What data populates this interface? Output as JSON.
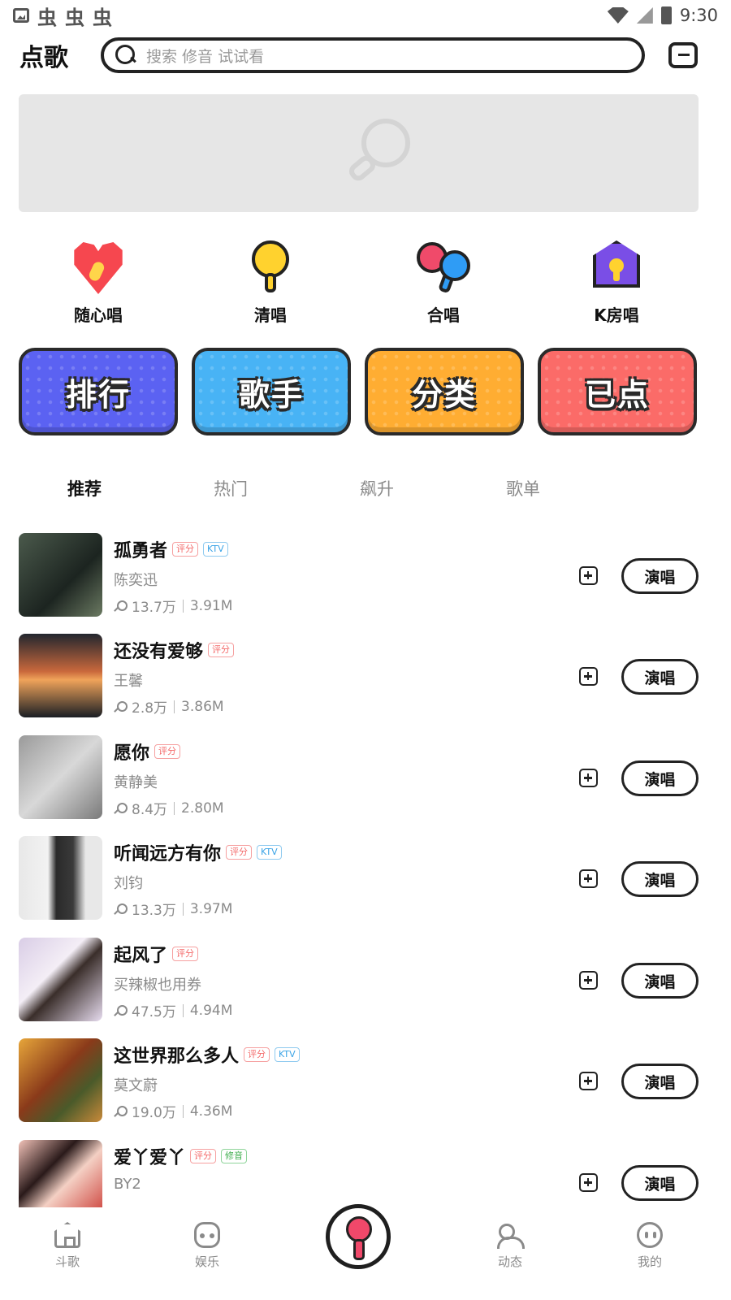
{
  "status_bar": {
    "time": "9:30",
    "bug_icons": [
      "虫",
      "虫",
      "虫"
    ]
  },
  "header": {
    "title": "点歌",
    "search_placeholder": "搜索 修音 试试看"
  },
  "quick_actions": [
    {
      "label": "随心唱",
      "icon": "heart-mic-icon"
    },
    {
      "label": "清唱",
      "icon": "yellow-mic-icon"
    },
    {
      "label": "合唱",
      "icon": "duet-mic-icon"
    },
    {
      "label": "K房唱",
      "icon": "ktv-room-icon"
    }
  ],
  "categories": [
    {
      "label": "排行",
      "color": "#5b62f2"
    },
    {
      "label": "歌手",
      "color": "#48b3f5"
    },
    {
      "label": "分类",
      "color": "#ffad32"
    },
    {
      "label": "已点",
      "color": "#fb6b68"
    }
  ],
  "tabs": [
    "推荐",
    "热门",
    "飙升",
    "歌单"
  ],
  "active_tab": "推荐",
  "songs": [
    {
      "title": "孤勇者",
      "tags": [
        "评分",
        "KTV"
      ],
      "artist": "陈奕迅",
      "plays": "13.7万",
      "size": "3.91M"
    },
    {
      "title": "还没有爱够",
      "tags": [
        "评分"
      ],
      "artist": "王馨",
      "plays": "2.8万",
      "size": "3.86M"
    },
    {
      "title": "愿你",
      "tags": [
        "评分"
      ],
      "artist": "黄静美",
      "plays": "8.4万",
      "size": "2.80M"
    },
    {
      "title": "听闻远方有你",
      "tags": [
        "评分",
        "KTV"
      ],
      "artist": "刘钧",
      "plays": "13.3万",
      "size": "3.97M"
    },
    {
      "title": "起风了",
      "tags": [
        "评分"
      ],
      "artist": "买辣椒也用券",
      "plays": "47.5万",
      "size": "4.94M"
    },
    {
      "title": "这世界那么多人",
      "tags": [
        "评分",
        "KTV"
      ],
      "artist": "莫文蔚",
      "plays": "19.0万",
      "size": "4.36M"
    },
    {
      "title": "爱丫爱丫",
      "tags": [
        "评分",
        "修音"
      ],
      "artist": "BY2",
      "plays": "",
      "size": ""
    }
  ],
  "sing_label": "演唱",
  "bottom_nav": [
    {
      "label": "斗歌",
      "icon": "home-icon"
    },
    {
      "label": "娱乐",
      "icon": "game-icon"
    },
    {
      "label": "动态",
      "icon": "people-icon"
    },
    {
      "label": "我的",
      "icon": "profile-icon"
    }
  ],
  "colors": {
    "accent": "#f0486a",
    "tag_score": "#f46a6a",
    "tag_ktv": "#3aa3e6",
    "tag_tune": "#3fae4e"
  }
}
